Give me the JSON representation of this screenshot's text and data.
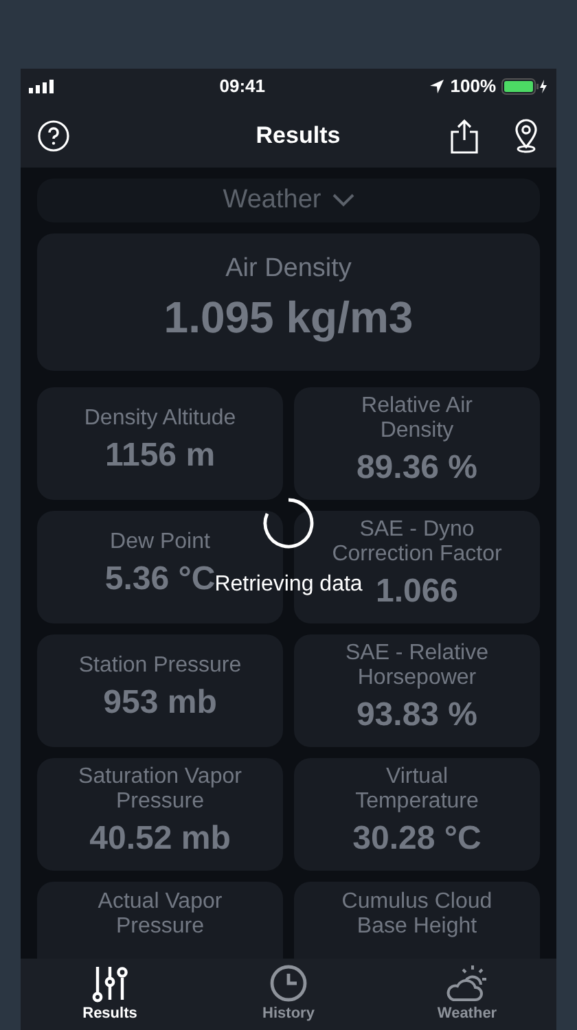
{
  "status_bar": {
    "time": "09:41",
    "battery": "100%"
  },
  "nav": {
    "title": "Results"
  },
  "selector": {
    "label": "Weather"
  },
  "main_tile": {
    "label": "Air Density",
    "value": "1.095 kg/m3"
  },
  "tiles": [
    {
      "label": "Density Altitude",
      "value": "1156 m"
    },
    {
      "label": "Relative Air Density",
      "value": "89.36 %"
    },
    {
      "label": "Dew Point",
      "value": "5.36 °C"
    },
    {
      "label": "SAE - Dyno Correction Factor",
      "value": "1.066"
    },
    {
      "label": "Station Pressure",
      "value": "953 mb"
    },
    {
      "label": "SAE - Relative Horsepower",
      "value": "93.83 %"
    },
    {
      "label": "Saturation Vapor Pressure",
      "value": "40.52 mb"
    },
    {
      "label": "Virtual Temperature",
      "value": "30.28 °C"
    },
    {
      "label": "Actual Vapor Pressure"
    },
    {
      "label": "Cumulus Cloud Base Height"
    }
  ],
  "loading": {
    "message": "Retrieving data"
  },
  "tab_bar": [
    {
      "kind": "results",
      "label": "Results",
      "selected": true
    },
    {
      "kind": "history",
      "label": "History",
      "selected": false
    },
    {
      "kind": "weather",
      "label": "Weather",
      "selected": false
    }
  ]
}
